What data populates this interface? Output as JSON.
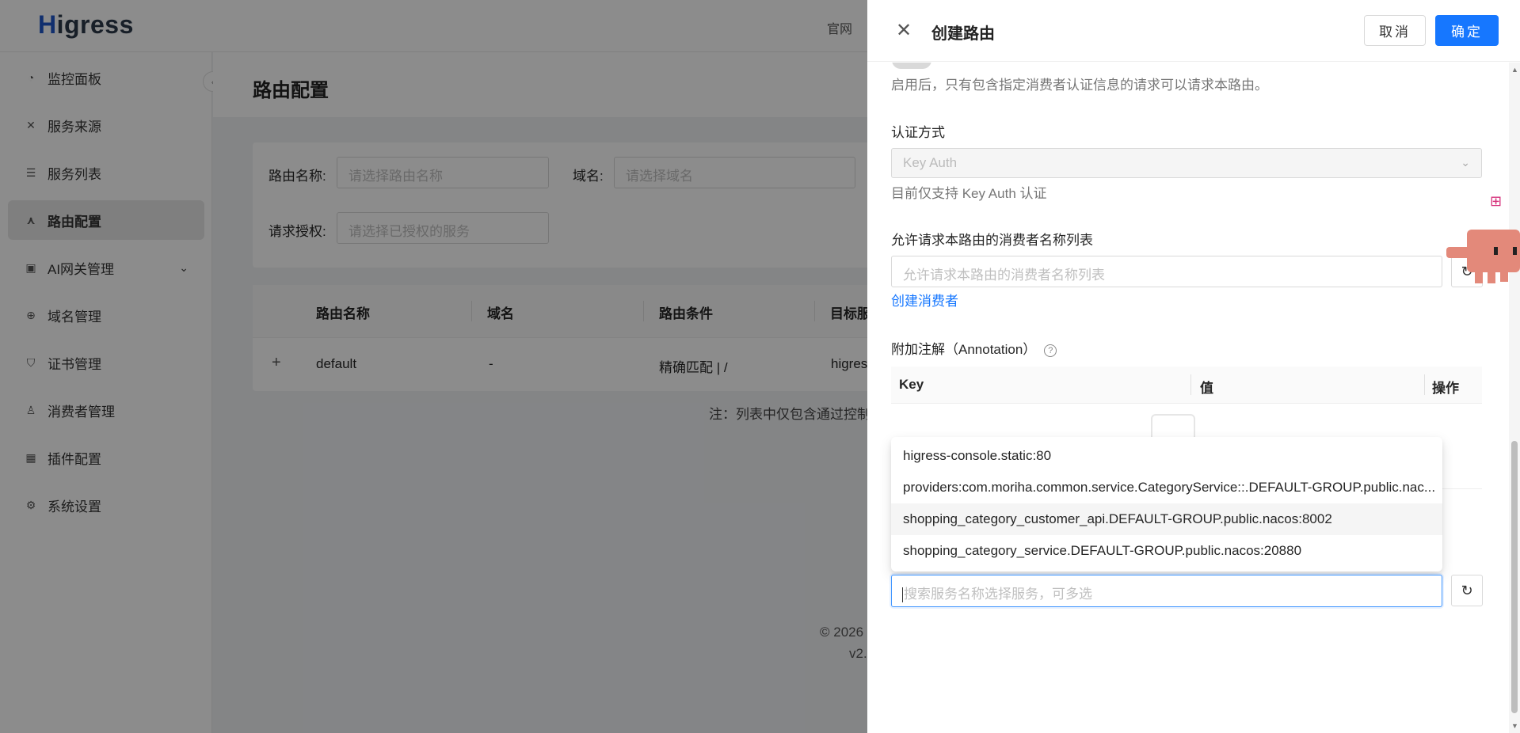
{
  "app": {
    "logo_mark": "H",
    "logo_text": "igress",
    "top_link": "官网",
    "sidebar": {
      "items": [
        {
          "label": "监控面板",
          "icon": "dashboard-icon"
        },
        {
          "label": "服务来源",
          "icon": "source-icon"
        },
        {
          "label": "服务列表",
          "icon": "list-icon"
        },
        {
          "label": "路由配置",
          "icon": "route-icon",
          "active": true
        },
        {
          "label": "AI网关管理",
          "icon": "ai-gateway-icon",
          "expandable": true
        },
        {
          "label": "域名管理",
          "icon": "globe-icon"
        },
        {
          "label": "证书管理",
          "icon": "certificate-icon"
        },
        {
          "label": "消费者管理",
          "icon": "user-icon"
        },
        {
          "label": "插件配置",
          "icon": "plugin-icon"
        },
        {
          "label": "系统设置",
          "icon": "gear-icon"
        }
      ]
    },
    "page_title": "路由配置",
    "filters": {
      "route_name_label": "路由名称:",
      "route_name_placeholder": "请选择路由名称",
      "domain_label": "域名:",
      "domain_placeholder": "请选择域名",
      "auth_label": "请求授权:",
      "auth_placeholder": "请选择已授权的服务"
    },
    "table": {
      "columns": [
        "路由名称",
        "域名",
        "路由条件",
        "目标服"
      ],
      "rows": [
        {
          "expand": "+",
          "name": "default",
          "domain": "-",
          "condition": "精确匹配 | /",
          "target": "higres"
        }
      ]
    },
    "note": "注：列表中仅包含通过控制",
    "copyright": "© 2026",
    "version": "v2."
  },
  "drawer": {
    "close_icon": "close-icon",
    "title": "创建路由",
    "cancel_label": "取消",
    "ok_label": "确定",
    "auth_hint": "启用后，只有包含指定消费者认证信息的请求可以请求本路由。",
    "auth_method_label": "认证方式",
    "auth_method_value": "Key Auth",
    "auth_method_hint": "目前仅支持 Key Auth 认证",
    "consumers_label": "允许请求本路由的消费者名称列表",
    "consumers_placeholder": "允许请求本路由的消费者名称列表",
    "create_consumer_link": "创建消费者",
    "annotation_label": "附加注解（Annotation）",
    "annotation_columns": {
      "key": "Key",
      "value": "值",
      "op": "操作"
    },
    "service_dropdown": [
      "higress-console.static:80",
      "providers:com.moriha.common.service.CategoryService::.DEFAULT-GROUP.public.nac...",
      "shopping_category_customer_api.DEFAULT-GROUP.public.nacos:8002",
      "shopping_category_service.DEFAULT-GROUP.public.nacos:20880"
    ],
    "service_dropdown_active_index": 2,
    "service_search_placeholder": "搜索服务名称选择服务，可多选"
  },
  "colors": {
    "primary": "#1677ff",
    "mask": "rgba(0,0,0,0.45)",
    "float_tool": "#d6337c",
    "mascot": "#e3897a"
  }
}
